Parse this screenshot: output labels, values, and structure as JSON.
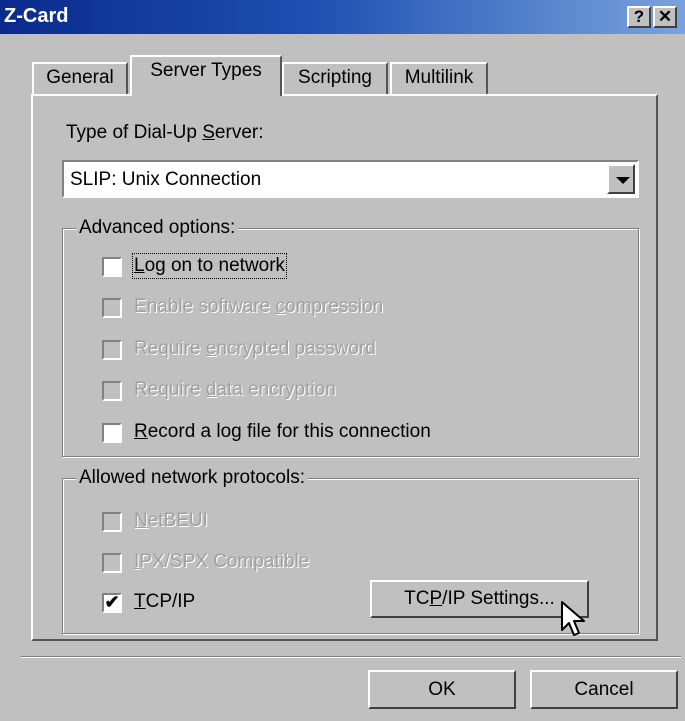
{
  "window": {
    "title": "Z-Card",
    "help_label": "?",
    "close_label": "✕"
  },
  "tabs": [
    {
      "label": "General",
      "active": false
    },
    {
      "label": "Server Types",
      "active": true
    },
    {
      "label": "Scripting",
      "active": false
    },
    {
      "label": "Multilink",
      "active": false
    }
  ],
  "server": {
    "label_pre": "Type of Dial-Up ",
    "label_key": "S",
    "label_post": "erver:",
    "value": "SLIP: Unix Connection"
  },
  "advanced": {
    "legend": "Advanced options:",
    "items": [
      {
        "pre": "",
        "key": "L",
        "post": "og on to network",
        "checked": false,
        "enabled": true
      },
      {
        "pre": "Enable software ",
        "key": "c",
        "post": "ompression",
        "checked": false,
        "enabled": false
      },
      {
        "pre": "Require ",
        "key": "e",
        "post": "ncrypted password",
        "checked": false,
        "enabled": false
      },
      {
        "pre": "Require ",
        "key": "d",
        "post": "ata encryption",
        "checked": false,
        "enabled": false
      },
      {
        "pre": "",
        "key": "R",
        "post": "ecord a log file for this connection",
        "checked": true,
        "enabled": true
      }
    ]
  },
  "protocols": {
    "legend": "Allowed network protocols:",
    "items": [
      {
        "pre": "",
        "key": "N",
        "post": "etBEUI",
        "checked": false,
        "enabled": false
      },
      {
        "pre": "",
        "key": "I",
        "post": "PX/SPX Compatible",
        "checked": false,
        "enabled": false
      },
      {
        "pre": "",
        "key": "T",
        "post": "CP/IP",
        "checked": true,
        "enabled": true
      }
    ],
    "settings_pre": "TC",
    "settings_key": "P",
    "settings_post": "/IP Settings..."
  },
  "footer": {
    "ok_label": "OK",
    "cancel_label": "Cancel"
  },
  "checkmark": "✔"
}
